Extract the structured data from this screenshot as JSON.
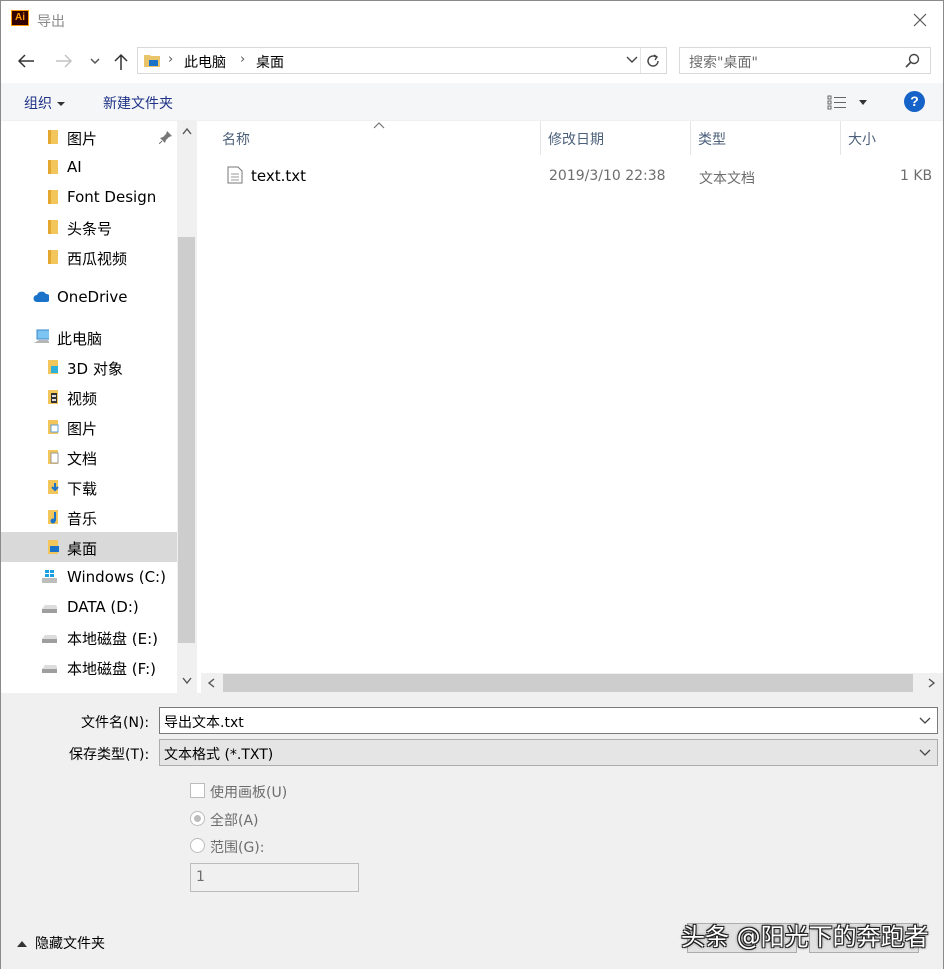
{
  "window": {
    "title": "导出",
    "app_icon_text": "Ai"
  },
  "navbar": {
    "address": [
      "此电脑",
      "桌面"
    ],
    "search_placeholder": "搜索\"桌面\""
  },
  "toolbar": {
    "organize": "组织",
    "new_folder": "新建文件夹",
    "help": "?"
  },
  "nav_pane": {
    "items": [
      {
        "label": "图片",
        "icon": "folder-icon",
        "pinned": true
      },
      {
        "label": "AI",
        "icon": "folder-icon"
      },
      {
        "label": "Font Design",
        "icon": "folder-icon"
      },
      {
        "label": "头条号",
        "icon": "folder-icon"
      },
      {
        "label": "西瓜视频",
        "icon": "folder-icon"
      },
      {
        "label": "OneDrive",
        "icon": "cloud-icon"
      },
      {
        "label": "此电脑",
        "icon": "computer-icon"
      },
      {
        "label": "3D 对象",
        "icon": "3d-objects-icon"
      },
      {
        "label": "视频",
        "icon": "video-folder-icon"
      },
      {
        "label": "图片",
        "icon": "pictures-folder-icon"
      },
      {
        "label": "文档",
        "icon": "documents-folder-icon"
      },
      {
        "label": "下载",
        "icon": "downloads-folder-icon"
      },
      {
        "label": "音乐",
        "icon": "music-folder-icon"
      },
      {
        "label": "桌面",
        "icon": "desktop-folder-icon",
        "selected": true
      },
      {
        "label": "Windows (C:)",
        "icon": "windows-drive-icon"
      },
      {
        "label": "DATA (D:)",
        "icon": "drive-icon"
      },
      {
        "label": "本地磁盘 (E:)",
        "icon": "drive-icon"
      },
      {
        "label": "本地磁盘 (F:)",
        "icon": "drive-icon"
      }
    ]
  },
  "file_list": {
    "columns": [
      "名称",
      "修改日期",
      "类型",
      "大小"
    ],
    "rows": [
      {
        "name": "text.txt",
        "modified": "2019/3/10 22:38",
        "type": "文本文档",
        "size": "1 KB"
      }
    ]
  },
  "form": {
    "filename_label": "文件名(N):",
    "filename_value": "导出文本.txt",
    "filetype_label": "保存类型(T):",
    "filetype_value": "文本格式 (*.TXT)",
    "use_artboards": "使用画板(U)",
    "all": "全部(A)",
    "range": "范围(G):",
    "range_value": "1",
    "hide_folders": "隐藏文件夹"
  },
  "watermark": "头条 @阳光下的奔跑者"
}
